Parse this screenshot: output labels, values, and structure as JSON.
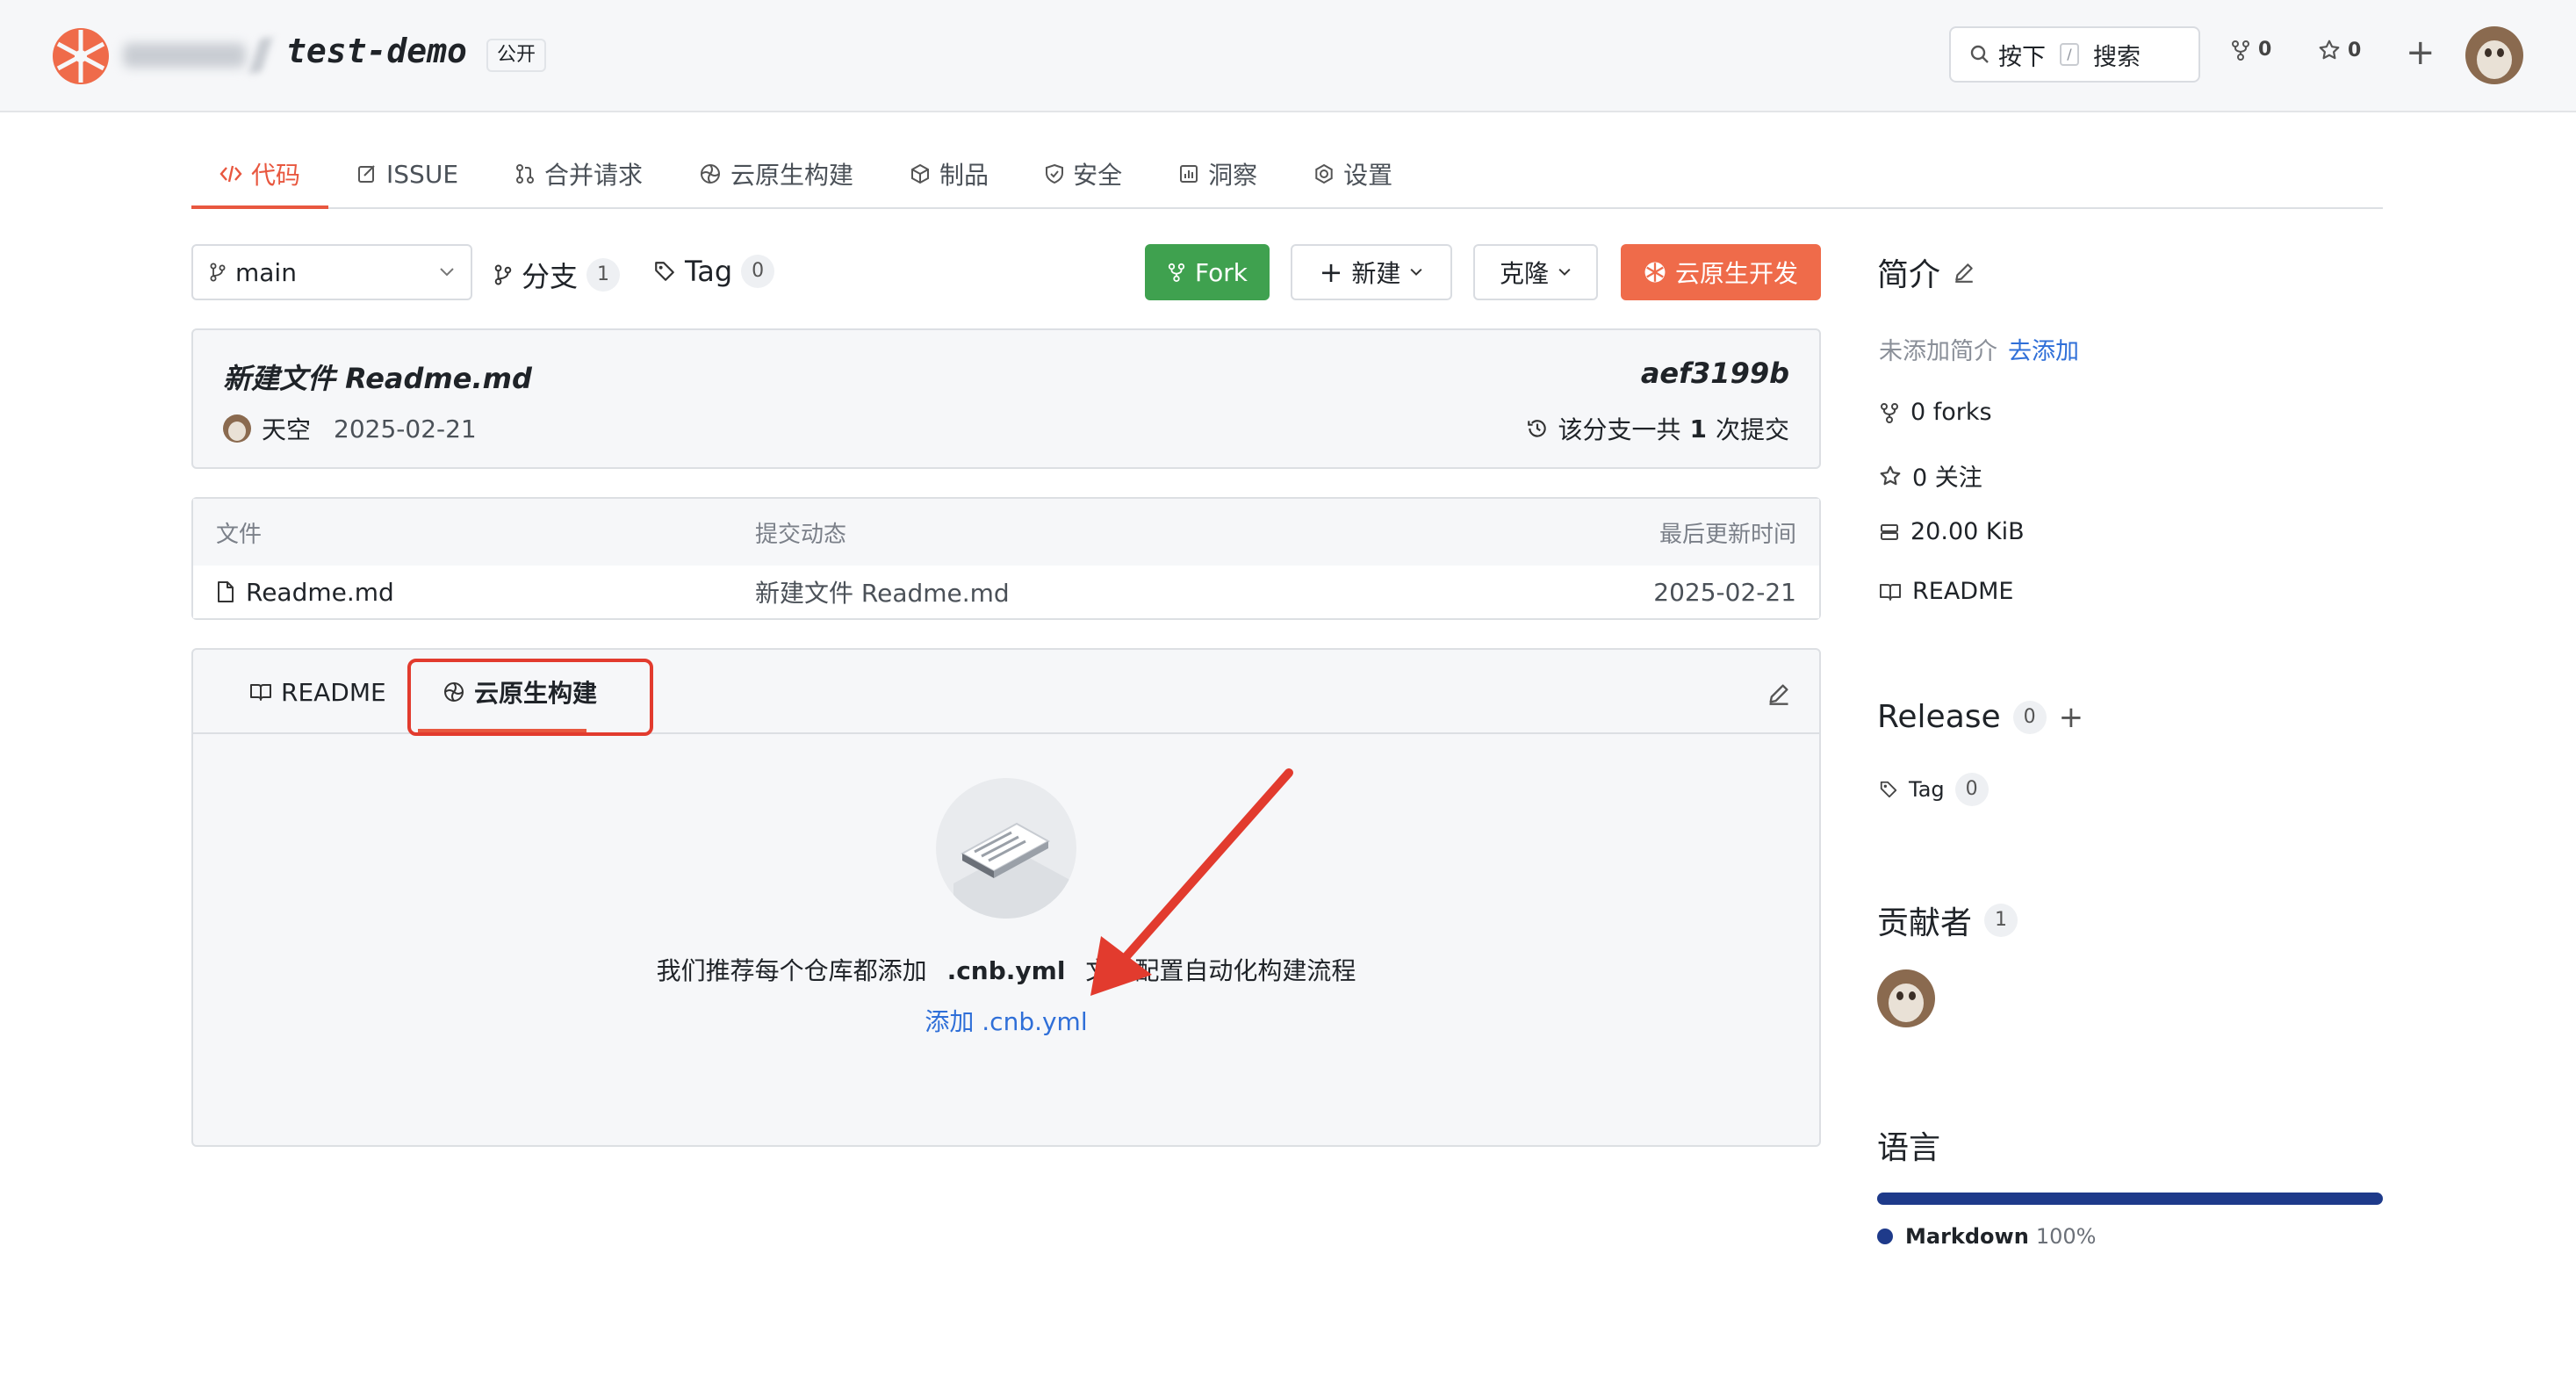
{
  "header": {
    "owner_hidden": "T-mike",
    "repo_name": "test-demo",
    "visibility": "公开",
    "search": {
      "shortcut_prefix": "按下",
      "shortcut_key": "/",
      "label": "搜索"
    },
    "forks": "0",
    "stars": "0"
  },
  "tabs": [
    {
      "label": "代码",
      "icon": "code-icon",
      "active": true
    },
    {
      "label": "ISSUE",
      "icon": "issue-icon"
    },
    {
      "label": "合并请求",
      "icon": "pull-request-icon"
    },
    {
      "label": "云原生构建",
      "icon": "build-icon"
    },
    {
      "label": "制品",
      "icon": "package-icon"
    },
    {
      "label": "安全",
      "icon": "shield-icon"
    },
    {
      "label": "洞察",
      "icon": "insights-icon"
    },
    {
      "label": "设置",
      "icon": "gear-icon"
    }
  ],
  "toolbar": {
    "branch": "main",
    "branches_label": "分支",
    "branches_count": "1",
    "tags_label": "Tag",
    "tags_count": "0",
    "fork_label": "Fork",
    "new_label": "新建",
    "clone_label": "克隆",
    "dev_label": "云原生开发"
  },
  "commit": {
    "message": "新建文件 Readme.md",
    "hash": "aef3199b",
    "author": "天空",
    "date": "2025-02-21",
    "count_prefix": "该分支一共",
    "count": "1",
    "count_suffix": "次提交"
  },
  "files": {
    "headers": [
      "文件",
      "提交动态",
      "最后更新时间"
    ],
    "rows": [
      {
        "name": "Readme.md",
        "commit": "新建文件 Readme.md",
        "updated": "2025-02-21"
      }
    ]
  },
  "panel": {
    "tab_readme": "README",
    "tab_build": "云原生构建",
    "empty_prefix": "我们推荐每个仓库都添加",
    "empty_file": ".cnb.yml",
    "empty_suffix": "文件配置自动化构建流程",
    "empty_link": "添加 .cnb.yml"
  },
  "sidebar": {
    "intro_title": "简介",
    "intro_empty": "未添加简介",
    "intro_add": "去添加",
    "forks": "0 forks",
    "watch": "0 关注",
    "size": "20.00 KiB",
    "readme": "README",
    "release_title": "Release",
    "release_count": "0",
    "tag_label": "Tag",
    "tag_count": "0",
    "contributors_title": "贡献者",
    "contributors_count": "1",
    "language_title": "语言",
    "language_name": "Markdown",
    "language_pct": "100%"
  },
  "colors": {
    "accent": "#e8573f",
    "fork_green": "#3fa14f",
    "link_blue": "#2f6fd8",
    "markdown_blue": "#1e3a8a",
    "annotation_red": "#e23b2e"
  }
}
